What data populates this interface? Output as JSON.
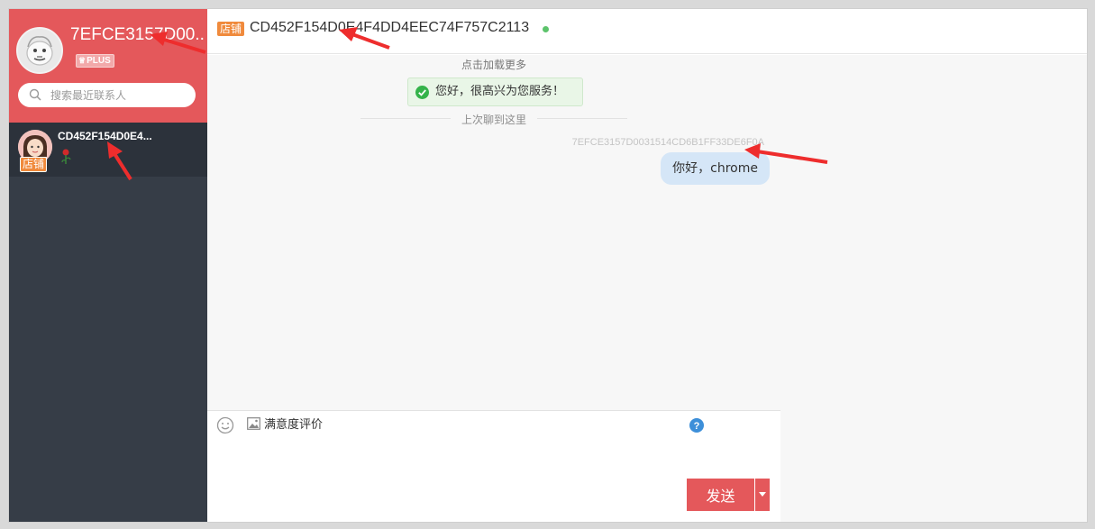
{
  "colors": {
    "brand_red": "#e4585b",
    "sidebar_bg": "#363d47",
    "shop_tag": "#f08a3c",
    "online": "#5cc36b",
    "bubble": "#d5e6f7",
    "annotation_arrow": "#ee2d2d"
  },
  "profile": {
    "name": "7EFCE3157D00...",
    "badge": "PLUS",
    "badge_icon": "crown-icon",
    "avatar_icon": "cartoon-avatar-icon"
  },
  "search": {
    "placeholder": "搜索最近联系人",
    "icon": "search-icon"
  },
  "contacts": [
    {
      "name": "CD452F154D0E4...",
      "tag": "店铺",
      "last_message_icon": "rose-icon",
      "avatar_icon": "girl-avatar-icon"
    }
  ],
  "chat": {
    "tag": "店铺",
    "title": "CD452F154D0E4F4DD4EEC74F757C2113",
    "status_icon": "online-dot-icon",
    "load_more": "点击加载更多",
    "welcome": "您好，很高兴为您服务！",
    "divider": "上次聊到这里",
    "messages": [
      {
        "sender": "7EFCE3157D0031514CD6B1FF33DE6F0A",
        "text": "你好，chrome"
      }
    ]
  },
  "composer": {
    "emoji_icon": "smiley-icon",
    "rate_label": "满意度评价",
    "help_icon": "question-mark-icon",
    "send_label": "发送",
    "dropdown_icon": "caret-down-icon"
  }
}
